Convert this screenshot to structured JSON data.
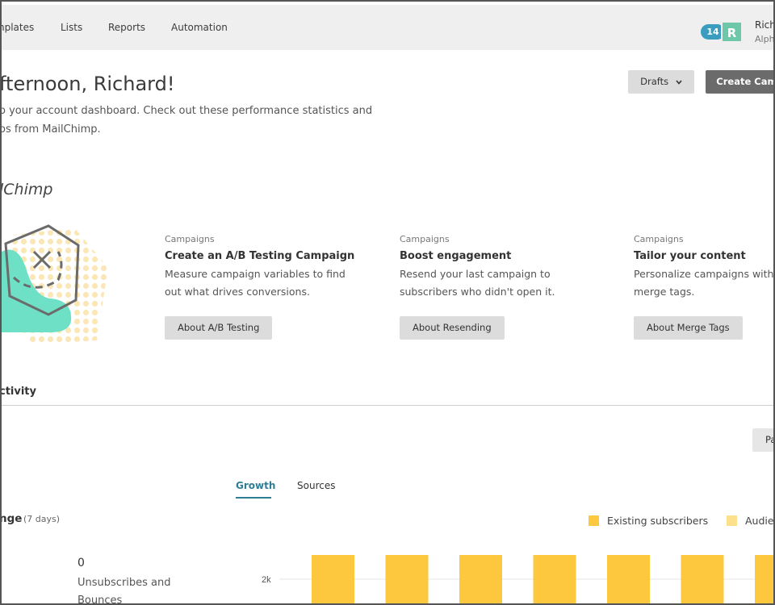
{
  "nav": {
    "items": [
      "nplates",
      "Lists",
      "Reports",
      "Automation"
    ],
    "notifications": "14",
    "avatar_letter": "R",
    "user_name": "Richa",
    "user_org": "Alpha"
  },
  "header": {
    "greeting": "fternoon, Richard!",
    "intro": "o your account dashboard. Check out these performance statistics and\nos from MailChimp.",
    "drafts_label": "Drafts",
    "create_label": "Create Camp"
  },
  "tips": {
    "title": "lChimp",
    "cards": [
      {
        "category": "Campaigns",
        "title": "Create an A/B Testing Campaign",
        "desc": "Measure campaign variables to find out what drives conversions.",
        "button": "About A/B Testing"
      },
      {
        "category": "Campaigns",
        "title": "Boost engagement",
        "desc": "Resend your last campaign to subscribers who didn't open it.",
        "button": "About Resending"
      },
      {
        "category": "Campaigns",
        "title": "Tailor your content",
        "desc": "Personalize campaigns with merge tags.",
        "button": "About Merge Tags"
      }
    ]
  },
  "activity": {
    "title": "ctivity",
    "period_button": "Pa",
    "tabs": [
      "Growth",
      "Sources"
    ],
    "change_title": "nge",
    "change_sub": "(7 days)",
    "stat_value": "0",
    "stat_label": "Unsubscribes and Bounces"
  },
  "chart_data": {
    "type": "bar",
    "series": [
      {
        "name": "Existing subscribers",
        "color": "#fdc73e"
      },
      {
        "name": "Audien",
        "color": "#fde08c"
      }
    ],
    "y_tick": "2k",
    "bar_count": 7
  }
}
